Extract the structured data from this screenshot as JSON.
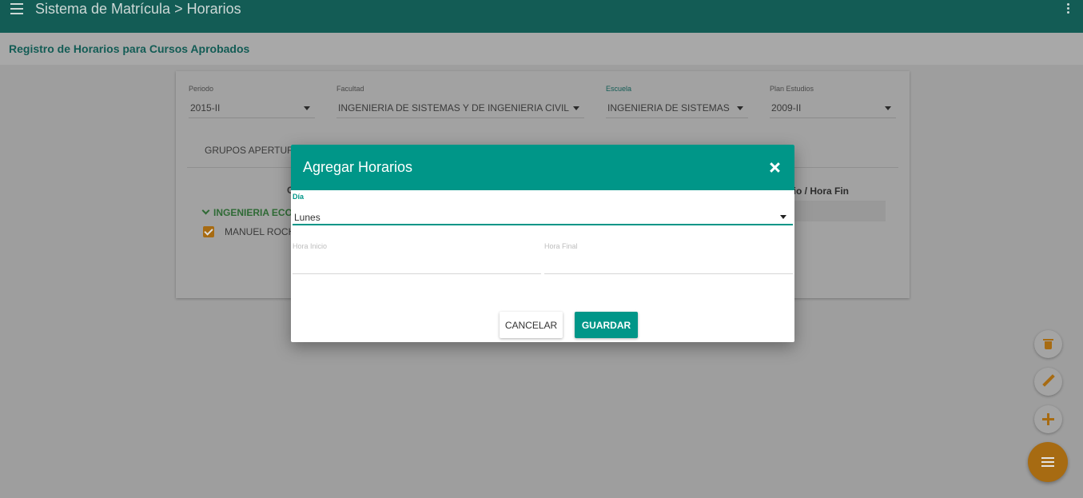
{
  "topbar": {
    "title": "Sistema de Matrícula > Horarios",
    "menu_icon": "menu-icon",
    "more_icon": "more-vert-icon"
  },
  "subheader": {
    "title": "Registro de Horarios para Cursos Aprobados"
  },
  "filters": {
    "periodo": {
      "label": "Periodo",
      "value": "2015-II"
    },
    "facultad": {
      "label": "Facultad",
      "value": "INGENIERIA DE SISTEMAS Y DE INGENIERIA CIVIL"
    },
    "escuela": {
      "label": "Escuela",
      "value": "INGENIERIA DE SISTEMAS"
    },
    "plan": {
      "label": "Plan Estudios",
      "value": "2009-II"
    }
  },
  "tab": {
    "label": "GRUPOS APERTUR"
  },
  "table": {
    "col_left_partial": "C",
    "col_right_partial": "cio / Hora Fin",
    "group_label": "INGENIERIA ECO",
    "teacher_label": "MANUEL ROCH"
  },
  "modal": {
    "title": "Agregar Horarios",
    "dia": {
      "label": "Día",
      "value": "Lunes"
    },
    "hora_inicio": {
      "label": "Hora Inicio",
      "value": ""
    },
    "hora_final": {
      "label": "Hora Final",
      "value": ""
    },
    "cancel_label": "CANCELAR",
    "save_label": "GUARDAR"
  },
  "fabs": {
    "delete_icon": "trash-icon",
    "edit_icon": "pencil-icon",
    "add_icon": "plus-icon",
    "menu_icon": "menu-icon"
  },
  "colors": {
    "primary": "#009688",
    "accent": "#f09f1d",
    "topbar": "#135c55"
  }
}
